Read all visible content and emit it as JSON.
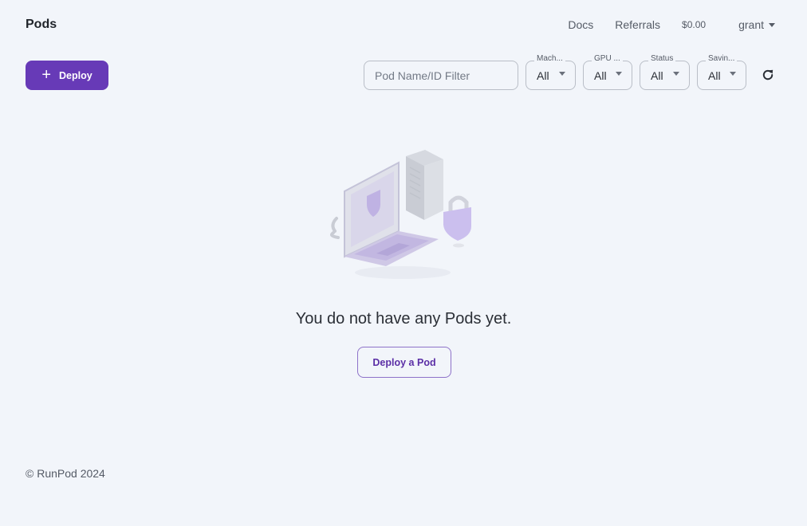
{
  "header": {
    "title": "Pods",
    "nav": {
      "docs": "Docs",
      "referrals": "Referrals"
    },
    "balance": "$0.00",
    "user": "grant"
  },
  "toolbar": {
    "deploy_label": "Deploy",
    "filter_placeholder": "Pod Name/ID Filter",
    "selects": {
      "machine": {
        "label": "Mach...",
        "value": "All"
      },
      "gpu": {
        "label": "GPU ...",
        "value": "All"
      },
      "status": {
        "label": "Status",
        "value": "All"
      },
      "savings": {
        "label": "Savin...",
        "value": "All"
      }
    }
  },
  "empty_state": {
    "message": "You do not have any Pods yet.",
    "button_label": "Deploy a Pod"
  },
  "footer": {
    "copyright": "© RunPod 2024"
  },
  "colors": {
    "accent": "#673ab7",
    "background": "#f2f5fa"
  },
  "icons": [
    "plus-icon",
    "chevron-down-icon",
    "refresh-icon",
    "empty-pods-illustration"
  ]
}
